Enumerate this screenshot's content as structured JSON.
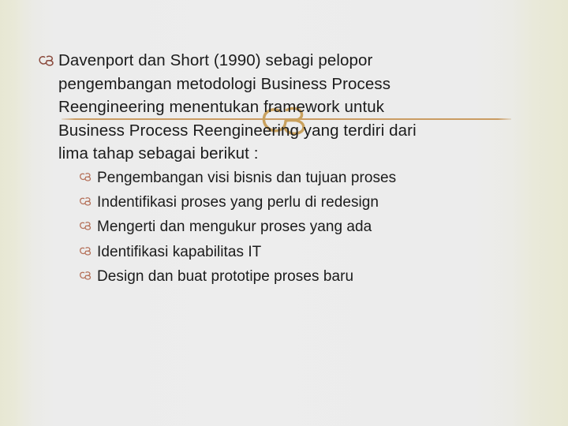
{
  "slide": {
    "background": {
      "edge_color": "#e7e7d3",
      "center_color": "#ededed"
    },
    "decoration": {
      "rule_color": "#c8985c",
      "ornament_color": "#c9a15e",
      "ornament_icon": "flourish-cb-ornament"
    },
    "body": {
      "bullet_icon": "flourish-cb-bullet",
      "bullet_color": "#8a4a3c",
      "text_color": "#1b1b1b",
      "paragraph_lines": [
        "Davenport dan Short (1990) sebagi pelopor",
        "pengembangan metodologi Business Process",
        "Reengineering menentukan framework untuk",
        "Business Process Reengineering yang terdiri dari",
        "lima tahap sebagai berikut :"
      ],
      "paragraph_full": "Davenport dan Short (1990) sebagi pelopor pengembangan metodologi Business Process Reengineering menentukan framework untuk Business Process Reengineering yang terdiri dari lima tahap sebagai berikut :"
    },
    "sublist": {
      "bullet_icon": "flourish-cb-bullet-small",
      "bullet_color": "#b5715a",
      "items": [
        "Pengembangan visi bisnis dan tujuan proses",
        "Indentifikasi proses yang perlu di redesign",
        "Mengerti dan mengukur proses yang ada",
        "Identifikasi kapabilitas IT",
        "Design dan buat prototipe proses baru"
      ]
    }
  }
}
